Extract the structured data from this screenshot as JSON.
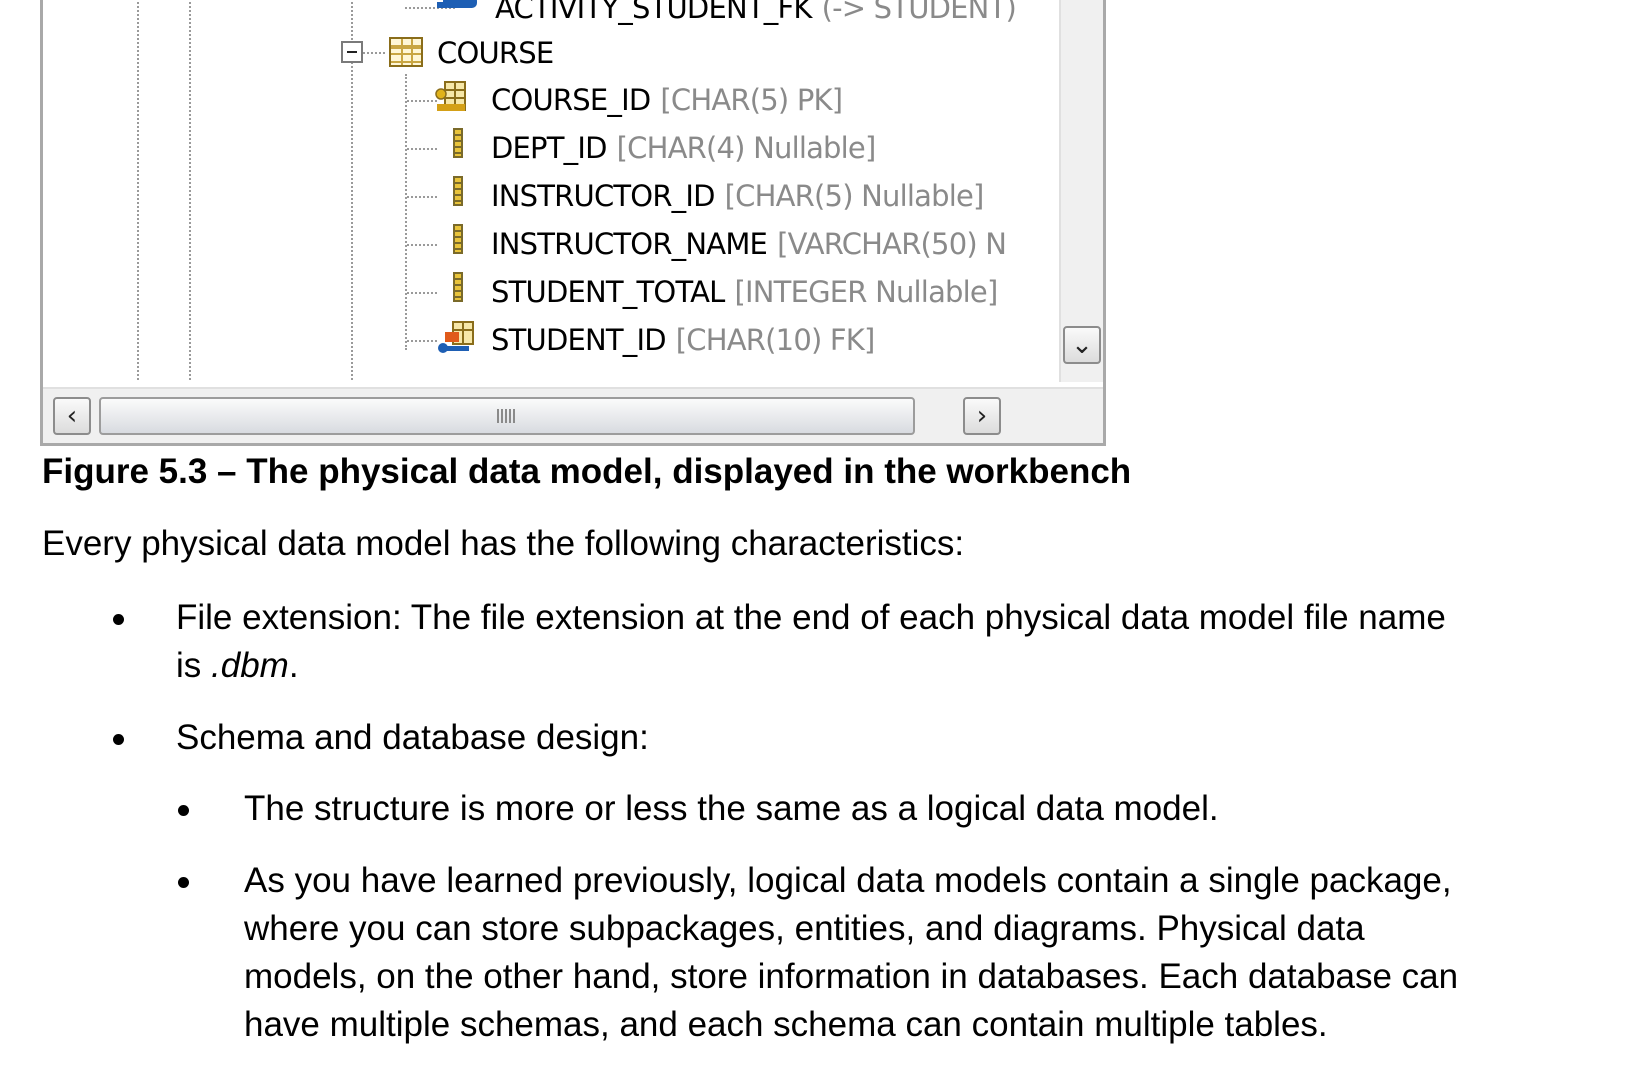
{
  "tree": {
    "partial_top_row": {
      "name": "ACTIVITY_STUDENT_FK",
      "type": "(-> STUDENT)"
    },
    "table": {
      "name": "COURSE"
    },
    "columns": [
      {
        "name": "COURSE_ID",
        "type": "[CHAR(5) PK]",
        "icon": "primary-key-icon"
      },
      {
        "name": "DEPT_ID",
        "type": "[CHAR(4) Nullable]",
        "icon": "column-icon"
      },
      {
        "name": "INSTRUCTOR_ID",
        "type": "[CHAR(5) Nullable]",
        "icon": "column-icon"
      },
      {
        "name": "INSTRUCTOR_NAME",
        "type": "[VARCHAR(50) N",
        "icon": "column-icon"
      },
      {
        "name": "STUDENT_TOTAL",
        "type": "[INTEGER Nullable]",
        "icon": "column-icon"
      },
      {
        "name": "STUDENT_ID",
        "type": "[CHAR(10) FK]",
        "icon": "foreign-key-icon"
      }
    ]
  },
  "caption": "Figure 5.3 – The physical data model, displayed in the workbench",
  "intro": "Every physical data model has the following characteristics:",
  "bullets": {
    "b1_line1": "File extension: The file extension at the end of each physical data model file name",
    "b1_line2_prefix": "is ",
    "b1_line2_italic": ".dbm",
    "b1_line2_suffix": ".",
    "b2": "Schema and database design:",
    "b2_1": "The structure is more or less the same as a logical data model.",
    "b2_2_line1": "As you have learned previously, logical data models contain a single package,",
    "b2_2_line2": "where you can store subpackages, entities, and diagrams. Physical data",
    "b2_2_line3": "models, on the other hand, store information in databases. Each database can",
    "b2_2_line4": "have multiple schemas, and each schema can contain multiple tables."
  }
}
